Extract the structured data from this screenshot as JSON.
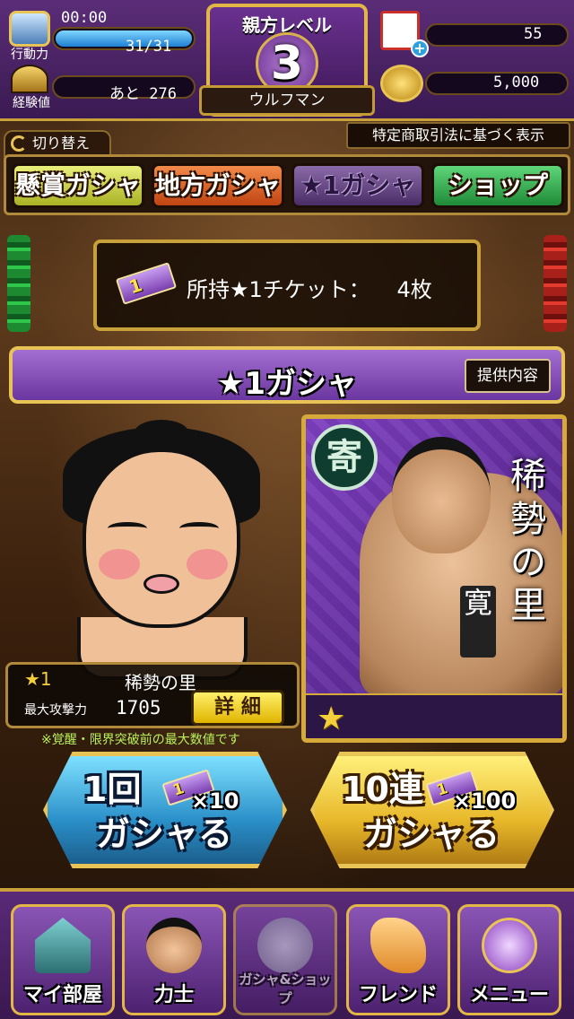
{
  "status": {
    "stamina_label": "行動力",
    "stamina_timer": "00:00",
    "stamina_value": "31/31",
    "stamina_ratio": 1.0,
    "exp_label": "経験値",
    "exp_remaining": "あと 276",
    "tickets_count": "55",
    "coins_count": "5,000"
  },
  "level": {
    "title": "親方レベル",
    "value": "3",
    "player_name": "ウルフマン"
  },
  "legal_link": "特定商取引法に基づく表示",
  "switch_label": "切り替え",
  "tabs": [
    {
      "label": "懸賞ガシャ",
      "color": "#c9d24a"
    },
    {
      "label": "地方ガシャ",
      "color": "#e0622a"
    },
    {
      "label": "★1ガシャ",
      "color": "#6b4a8a"
    },
    {
      "label": "ショップ",
      "color": "#2fa84a"
    }
  ],
  "ticket": {
    "icon_text": "1",
    "label": "所持★1チケット：",
    "count": "4枚"
  },
  "gacha": {
    "title": "★1ガシャ",
    "contents_button": "提供内容"
  },
  "card": {
    "rank_char": "寄",
    "name": "稀勢の里",
    "sub_name": "寛",
    "stars": "★"
  },
  "info": {
    "stars": "★1",
    "name": "稀勢の里",
    "atk_label": "最大攻撃力",
    "atk_value": "1705",
    "detail_button": "詳 細",
    "note": "※覚醒・限界突破前の最大数値です"
  },
  "pulls": [
    {
      "label_top": "1回",
      "label_bottom": "ガシャる",
      "ticket_icon": "1",
      "cost": "×10"
    },
    {
      "label_top": "10連",
      "label_bottom": "ガシャる",
      "ticket_icon": "1",
      "cost": "×100"
    }
  ],
  "nav": [
    {
      "label": "マイ部屋",
      "icon": "stable-house-icon"
    },
    {
      "label": "力士",
      "icon": "wrestler-face-icon"
    },
    {
      "label": "ガシャ&ショップ",
      "icon": "gacha-capsule-icon"
    },
    {
      "label": "フレンド",
      "icon": "handshake-icon"
    },
    {
      "label": "メニュー",
      "icon": "crest-menu-icon"
    }
  ]
}
